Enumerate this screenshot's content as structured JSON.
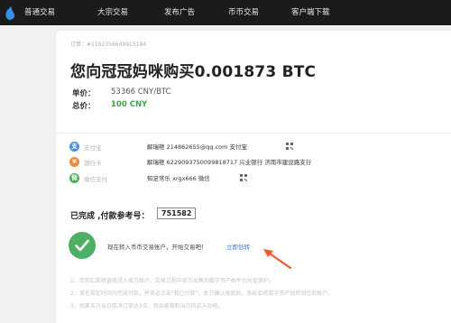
{
  "topbar": {
    "nav": [
      "普通交易",
      "大宗交易",
      "发布广告",
      "币币交易",
      "客户端下载"
    ]
  },
  "order": {
    "order_no": "订单：#1192356649915194",
    "headline": "您向冠冠妈咪购买0.001873 BTC",
    "price_label": "单价：",
    "price_value": "53366 CNY/BTC",
    "total_label": "总价：",
    "total_value": "100 CNY"
  },
  "payments": [
    {
      "icon": "alipay-icon",
      "color": "#4a90e2",
      "glyph": "支",
      "name": "支付宝",
      "detail": "解瑞艳  214862655@qq.com  支付宝"
    },
    {
      "icon": "bank-card-icon",
      "color": "#f08a3c",
      "glyph": "¥",
      "name": "银行卡",
      "detail": "解瑞艳  6229093750099818717  兴业银行  济南市建设路支行"
    },
    {
      "icon": "wechat-pay-icon",
      "color": "#4caf50",
      "glyph": "微",
      "name": "微信支付",
      "detail": "知足常乐  xrgx666  微信"
    }
  ],
  "completion": {
    "label": "已完成 ,付款参考号：",
    "reference_code": "751582"
  },
  "notice": {
    "text": "现在转入币币交易账户，开始交易吧！",
    "link": "立即划转"
  },
  "tips": [
    "1、您的汇款将直接进入卖方账户，交易过程中卖方出售的数字资产由平台托管保护。",
    "2、请在规定时间内完成付款，并务必点击\"我已付款\"，卖方确认收款后，系统会将数字资产划转到您的账户。",
    "3、如果买方当日取消订单达3次，将会被限制当日的买入功能。"
  ],
  "colors": {
    "topbar": "#1b1b1b",
    "total_value": "#43a047",
    "success_circle": "#4caf63",
    "link": "#3a7bd5",
    "arrow": "#f05a28"
  }
}
